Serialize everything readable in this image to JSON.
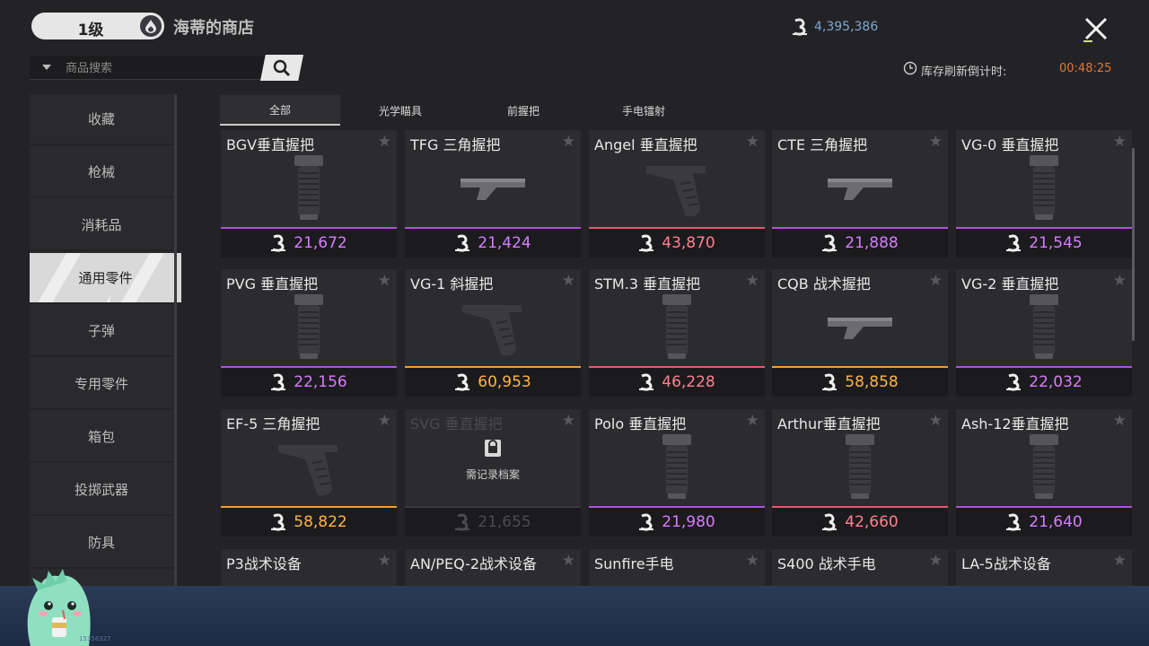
{
  "header": {
    "level": "1级",
    "shop_title": "海蒂的商店",
    "currency_amount": "4,395,386",
    "refresh_label": "库存刷新倒计时:",
    "refresh_time": "00:48:25"
  },
  "search": {
    "placeholder": "商品搜索"
  },
  "sidebar": {
    "items": [
      {
        "label": "收藏"
      },
      {
        "label": "枪械"
      },
      {
        "label": "消耗品"
      },
      {
        "label": "通用零件",
        "active": true
      },
      {
        "label": "子弹"
      },
      {
        "label": "专用零件"
      },
      {
        "label": "箱包"
      },
      {
        "label": "投掷武器"
      },
      {
        "label": "防具"
      }
    ]
  },
  "tabs": [
    {
      "label": "全部",
      "active": true
    },
    {
      "label": "光学瞄具"
    },
    {
      "label": "前握把"
    },
    {
      "label": "手电镭射"
    }
  ],
  "items": [
    {
      "name": "BGV垂直握把",
      "price": "21,672",
      "rarity": "purple",
      "icon": "vertical-grip-icon"
    },
    {
      "name": "TFG 三角握把",
      "price": "21,424",
      "rarity": "purple",
      "icon": "triangle-grip-icon"
    },
    {
      "name": "Angel 垂直握把",
      "price": "43,870",
      "rarity": "red",
      "icon": "angled-grip-icon"
    },
    {
      "name": "CTE 三角握把",
      "price": "21,888",
      "rarity": "purple",
      "icon": "triangle-grip-icon"
    },
    {
      "name": "VG-0 垂直握把",
      "price": "21,545",
      "rarity": "purple",
      "icon": "vertical-grip-icon"
    },
    {
      "name": "PVG 垂直握把",
      "price": "22,156",
      "rarity": "purple",
      "icon": "vertical-grip-icon"
    },
    {
      "name": "VG-1 斜握把",
      "price": "60,953",
      "rarity": "orange",
      "icon": "angled-grip-icon"
    },
    {
      "name": "STM.3 垂直握把",
      "price": "46,228",
      "rarity": "red",
      "icon": "vertical-grip-icon"
    },
    {
      "name": "CQB 战术握把",
      "price": "58,858",
      "rarity": "orange",
      "icon": "triangle-grip-icon"
    },
    {
      "name": "VG-2 垂直握把",
      "price": "22,032",
      "rarity": "purple",
      "icon": "vertical-grip-icon"
    },
    {
      "name": "EF-5 三角握把",
      "price": "58,822",
      "rarity": "orange",
      "icon": "angled-grip-icon"
    },
    {
      "name": "SVG 垂直握把",
      "price": "21,655",
      "rarity": "locked",
      "icon": "lock-icon",
      "locked_text": "需记录档案"
    },
    {
      "name": "Polo 垂直握把",
      "price": "21,980",
      "rarity": "purple",
      "icon": "vertical-grip-icon"
    },
    {
      "name": "Arthur垂直握把",
      "price": "42,660",
      "rarity": "red",
      "icon": "vertical-grip-icon"
    },
    {
      "name": "Ash-12垂直握把",
      "price": "21,640",
      "rarity": "purple",
      "icon": "vertical-grip-icon"
    },
    {
      "name": "P3战术设备",
      "partial": true
    },
    {
      "name": "AN/PEQ-2战术设备",
      "partial": true
    },
    {
      "name": "Sunfire手电",
      "partial": true
    },
    {
      "name": "S400 战术手电",
      "partial": true
    },
    {
      "name": "LA-5战术设备",
      "partial": true
    }
  ],
  "colors": {
    "purple": "#b34fe0",
    "red": "#e05a6e",
    "orange": "#f0a033",
    "locked": "#3a3a3e",
    "price_purple": "#d77cff",
    "price_red": "#ff7f92",
    "price_orange": "#ffb545"
  },
  "overlay": {
    "stream_id": "15356327"
  }
}
